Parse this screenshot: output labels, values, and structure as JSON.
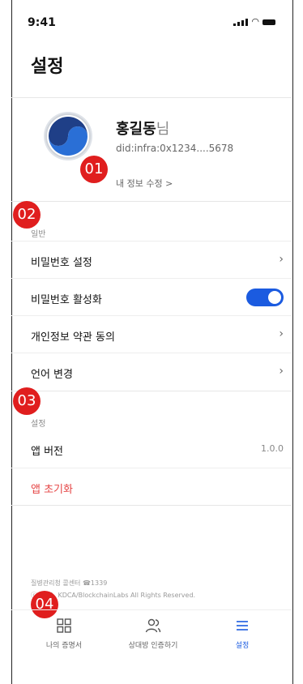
{
  "status": {
    "time": "9:41"
  },
  "header": {
    "title": "설정"
  },
  "profile": {
    "name": "홍길동",
    "name_suffix": "님",
    "did": "did:infra:0x1234....5678",
    "edit_label": "내 정보 수정 >"
  },
  "badges": [
    "01",
    "02",
    "03",
    "04"
  ],
  "sections": {
    "general": {
      "label": "일반",
      "items": [
        {
          "label": "비밀번호 설정"
        },
        {
          "label": "비밀번호 활성화"
        },
        {
          "label": "개인정보 약관 동의"
        },
        {
          "label": "언어 변경"
        }
      ],
      "toggle_on": true
    },
    "settings": {
      "label": "설정",
      "items": [
        {
          "label": "앱 버전",
          "value": "1.0.0"
        },
        {
          "label": "앱 초기화"
        }
      ]
    }
  },
  "footer": {
    "line1": "질병관리청 콜센터 ☎1339",
    "line2": "ⓒ2021. KDCA/BlockchainLabs  All Rights Reserved."
  },
  "tabs": [
    {
      "label": "나의 증명서",
      "icon": "grid-icon"
    },
    {
      "label": "상대방 인증하기",
      "icon": "users-icon"
    },
    {
      "label": "설정",
      "icon": "menu-icon",
      "active": true
    }
  ],
  "colors": {
    "accent": "#1b5be0",
    "danger": "#e54545",
    "badge": "#e01e1e"
  }
}
